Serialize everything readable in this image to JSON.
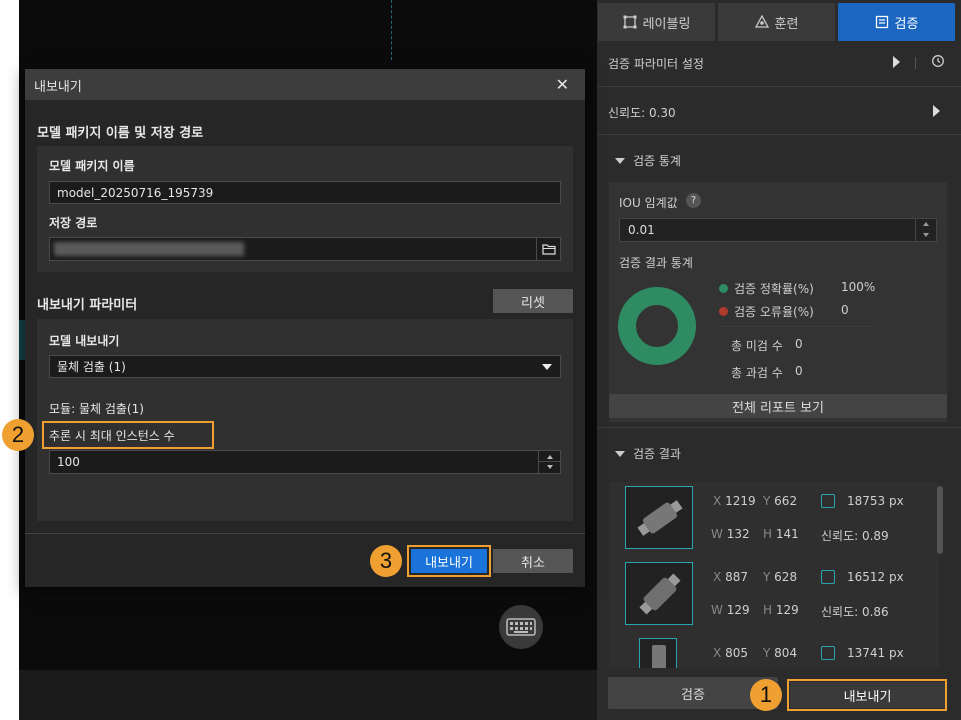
{
  "tabs": [
    {
      "label": "레이블링",
      "icon": "labeling-icon"
    },
    {
      "label": "훈련",
      "icon": "training-icon"
    },
    {
      "label": "검증",
      "icon": "validation-icon"
    }
  ],
  "panel": {
    "param_settings": "검증 파라미터 설정",
    "confidence": "신뢰도: 0.30",
    "stats_section": "검증 통계",
    "iou_label": "IOU 임계값",
    "iou_help": "?",
    "iou_value": "0.01",
    "result_stats_label": "검증 결과 통계",
    "accuracy_label": "검증 정확률(%)",
    "accuracy_value": "100%",
    "error_label": "검증 오류율(%)",
    "error_value": "0",
    "missed_label": "총 미검 수",
    "missed_value": "0",
    "over_label": "총 과검 수",
    "over_value": "0",
    "full_report": "전체 리포트 보기",
    "results_section": "검증 결과",
    "results": [
      {
        "x": "1219",
        "y": "662",
        "area": "18753 px",
        "w": "132",
        "h": "141",
        "conf": "신뢰도: 0.89"
      },
      {
        "x": "887",
        "y": "628",
        "area": "16512 px",
        "w": "129",
        "h": "129",
        "conf": "신뢰도: 0.86"
      },
      {
        "x": "805",
        "y": "804",
        "area": "13741 px",
        "w": "",
        "h": "",
        "conf": ""
      }
    ],
    "result_keys": {
      "x": "X",
      "y": "Y",
      "w": "W",
      "h": "H"
    },
    "validate_btn": "검증",
    "export_btn": "내보내기",
    "colors": {
      "accuracy": "#2e8b62",
      "error": "#b03a2e",
      "active_tab": "#1a66c0"
    }
  },
  "dialog": {
    "title": "내보내기",
    "close": "✕",
    "section1": "모델 패키지 이름 및 저장 경로",
    "pkg_name_label": "모델 패키지 이름",
    "pkg_name_value": "model_20250716_195739",
    "save_path_label": "저장 경로",
    "save_path_value": "",
    "section2": "내보내기 파라미터",
    "reset_btn": "리셋",
    "export_model_label": "모델 내보내기",
    "export_model_value": "물체 검출 (1)",
    "module_text": "모듈: 물체 검출(1)",
    "max_instances_label": "추론 시 최대 인스턴스 수",
    "max_instances_value": "100",
    "export_btn": "내보내기",
    "cancel_btn": "취소"
  },
  "callouts": [
    "1",
    "2",
    "3"
  ],
  "accent": "#f0a030"
}
